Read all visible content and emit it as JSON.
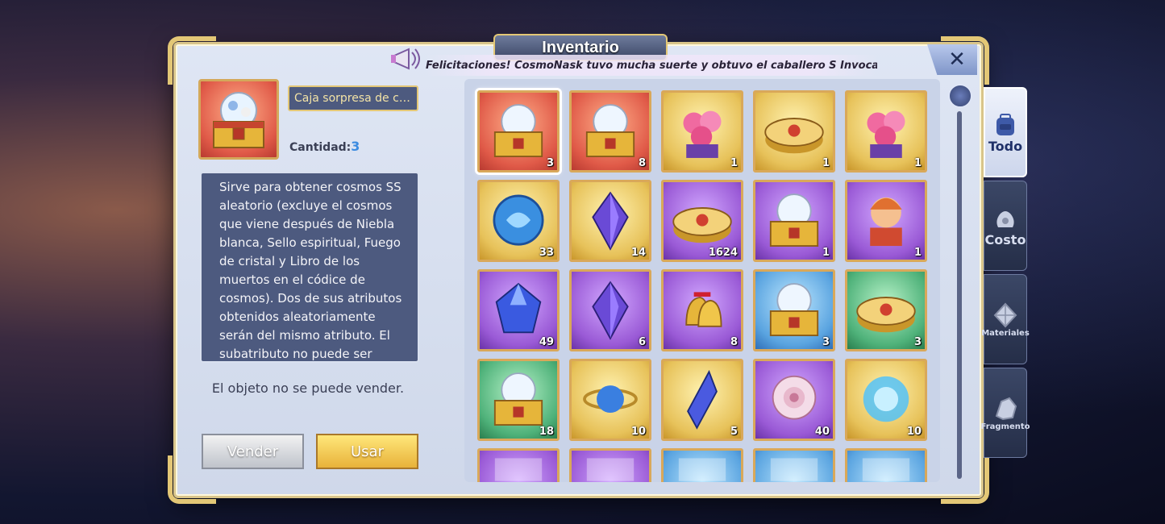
{
  "window": {
    "title": "Inventario",
    "close_label": "✕"
  },
  "broadcast": {
    "text": "Felicitaciones! CosmoNask tuvo mucha suerte y obtuvo el caballero S Invocación temática"
  },
  "selected_item": {
    "name": "Caja sorpresa de cosm...",
    "quantity_label": "Cantidad:",
    "quantity_value": "3",
    "description": "Sirve para obtener cosmos SS aleatorio (excluye el cosmos que viene después de Niebla blanca, Sello espiritual, Fuego de cristal y Libro de los muertos en el códice de cosmos). Dos de sus atributos obtenidos aleatoriamente serán del mismo atributo. El subatributo no puede ser completamente opuesto al efecto del cosmos",
    "sell_note": "El objeto no se puede vender.",
    "sell_button": "Vender",
    "use_button": "Usar"
  },
  "tabs": [
    {
      "label": "Todo",
      "icon": "backpack-icon",
      "active": true
    },
    {
      "label": "Costo",
      "icon": "money-bag-icon",
      "active": false
    },
    {
      "label": "Materiales",
      "icon": "crystal-icon",
      "active": false
    },
    {
      "label": "Fragmento",
      "icon": "fragment-icon",
      "active": false
    }
  ],
  "items": [
    {
      "name": "ss-cosmos-chest",
      "bg": "red",
      "count": "3",
      "selected": true
    },
    {
      "name": "ss-cosmos-chest-2",
      "bg": "red",
      "count": "8"
    },
    {
      "name": "pink-orchid-bouquet",
      "bg": "gold",
      "count": "1"
    },
    {
      "name": "golden-gift-box",
      "bg": "gold",
      "count": "1"
    },
    {
      "name": "flower-basket",
      "bg": "gold",
      "count": "1"
    },
    {
      "name": "blue-cosmos-orb",
      "bg": "gold",
      "count": "33"
    },
    {
      "name": "purple-crystal",
      "bg": "gold",
      "count": "14"
    },
    {
      "name": "purple-round-box",
      "bg": "purple",
      "count": "1624"
    },
    {
      "name": "s-cosmos-chest",
      "bg": "purple",
      "count": "1"
    },
    {
      "name": "chibi-saint-figure",
      "bg": "purple",
      "count": "1"
    },
    {
      "name": "blue-gem",
      "bg": "purple",
      "count": "49"
    },
    {
      "name": "fire-crystal",
      "bg": "purple",
      "count": "6"
    },
    {
      "name": "golden-bells",
      "bg": "purple",
      "count": "8"
    },
    {
      "name": "a-cosmos-chest",
      "bg": "blue",
      "count": "3"
    },
    {
      "name": "green-gift-box",
      "bg": "green",
      "count": "3"
    },
    {
      "name": "b-cosmos-chest",
      "bg": "green",
      "count": "18"
    },
    {
      "name": "orbit-orb",
      "bg": "gold",
      "count": "10"
    },
    {
      "name": "blue-shard",
      "bg": "gold",
      "count": "5"
    },
    {
      "name": "white-rose",
      "bg": "purple",
      "count": "40"
    },
    {
      "name": "blue-energy-burst",
      "bg": "gold",
      "count": "10"
    },
    {
      "name": "partial-item-1",
      "bg": "purple",
      "count": ""
    },
    {
      "name": "partial-item-2",
      "bg": "purple",
      "count": ""
    },
    {
      "name": "partial-item-3",
      "bg": "blue",
      "count": ""
    },
    {
      "name": "partial-item-4",
      "bg": "blue",
      "count": ""
    },
    {
      "name": "partial-item-5",
      "bg": "blue",
      "count": ""
    }
  ],
  "colors": {
    "accent_gold": "#e3c776",
    "panel_blue": "#4d5a7f",
    "quantity_blue": "#3c8be0"
  }
}
